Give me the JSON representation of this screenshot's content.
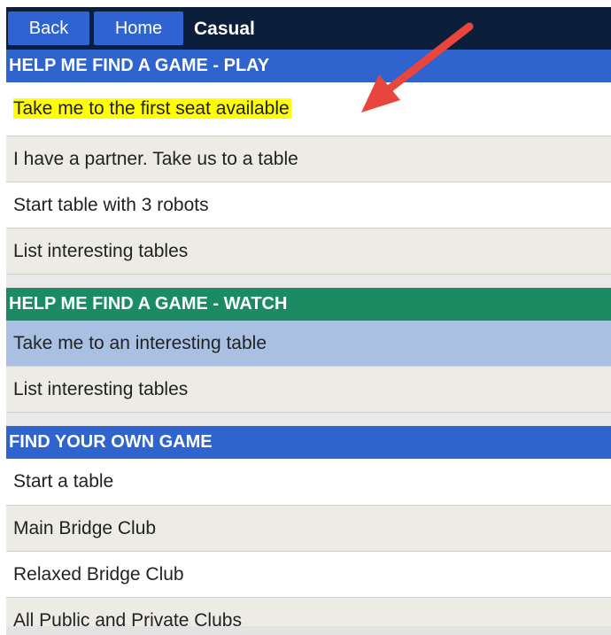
{
  "topbar": {
    "back_label": "Back",
    "home_label": "Home",
    "title": "Casual"
  },
  "sections": [
    {
      "header": "HELP ME FIND A GAME - PLAY",
      "items": [
        "Take me to the first seat available",
        "I have a partner. Take us to a table",
        "Start table with 3 robots",
        "List interesting tables"
      ]
    },
    {
      "header": "HELP ME FIND A GAME - WATCH",
      "items": [
        "Take me to an interesting table",
        "List interesting tables"
      ]
    },
    {
      "header": "FIND YOUR OWN GAME",
      "items": [
        "Start a table",
        "Main Bridge Club",
        "Relaxed Bridge Club",
        "All Public and Private Clubs"
      ]
    }
  ],
  "colors": {
    "topbar": "#0b1f3a",
    "button": "#2e63d1",
    "header_blue": "#2f64cf",
    "header_green": "#1c8a63",
    "row_beige": "#ecebe4",
    "row_selected": "#aac0e3",
    "highlight": "#ffff00",
    "annotation_arrow": "#e8453c"
  }
}
